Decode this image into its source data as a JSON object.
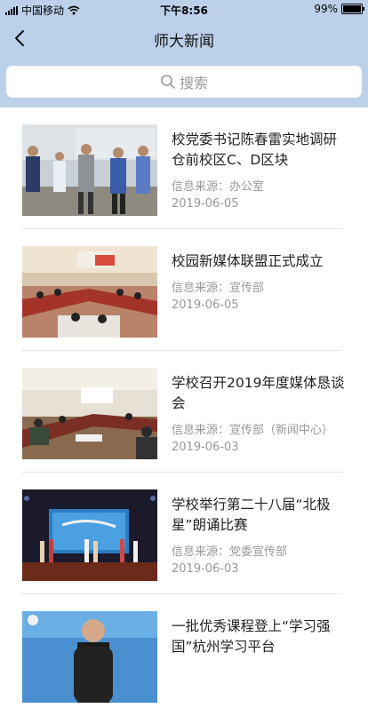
{
  "statusbar": {
    "carrier": "中国移动",
    "time": "下午8:56",
    "battery": "99%",
    "battery_level": 0.99
  },
  "nav": {
    "title": "师大新闻"
  },
  "search": {
    "placeholder": "搜索"
  },
  "news": [
    {
      "title": "校党委书记陈春雷实地调研仓前校区C、D区块",
      "source": "信息来源：办公室",
      "date": "2019-06-05"
    },
    {
      "title": "校园新媒体联盟正式成立",
      "source": "信息来源：宣传部",
      "date": "2019-06-05"
    },
    {
      "title": "学校召开2019年度媒体恳谈会",
      "source": "信息来源：宣传部（新闻中心）",
      "date": "2019-06-03"
    },
    {
      "title": "学校举行第二十八届“北极星”朗诵比赛",
      "source": "信息来源：党委宣传部",
      "date": "2019-06-03"
    },
    {
      "title": "一批优秀课程登上“学习强国”杭州学习平台"
    }
  ],
  "colors": {
    "header_bg": "#bcd0ea",
    "text": "#222222",
    "meta": "#999999"
  }
}
